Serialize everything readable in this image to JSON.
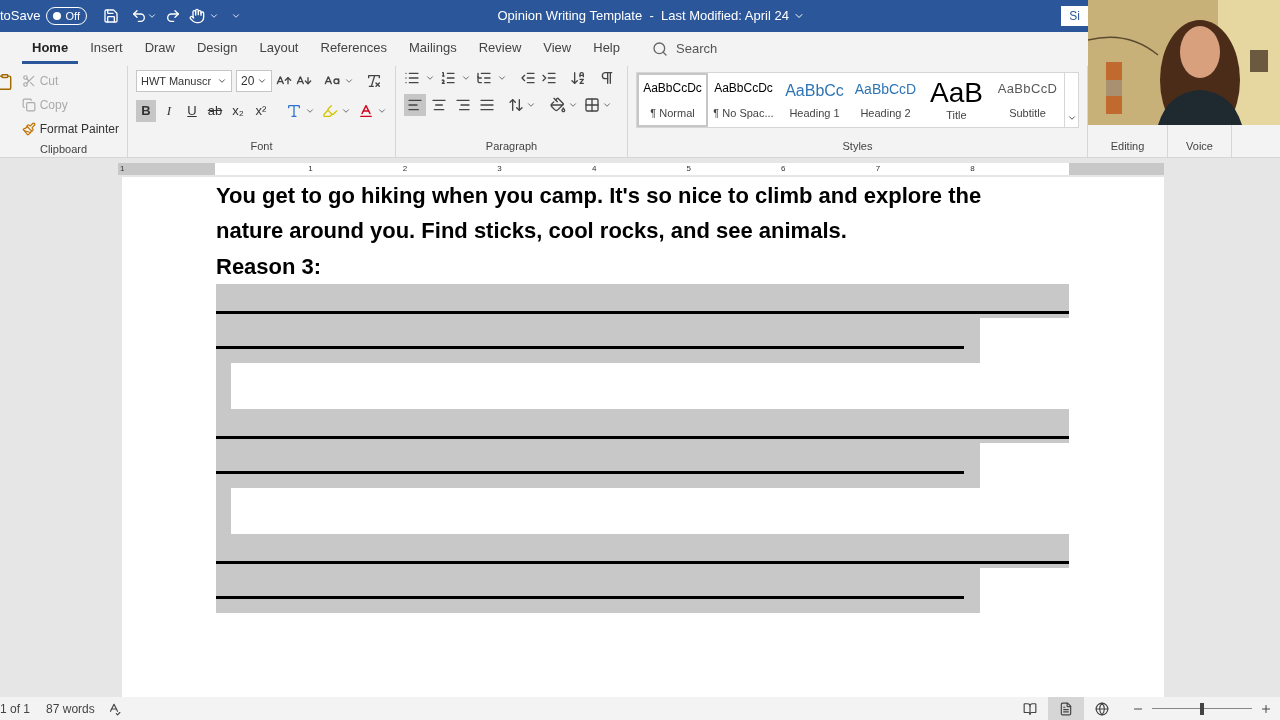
{
  "title_bar": {
    "autosave_label": "toSave",
    "autosave": {
      "label": "Off",
      "on": false
    },
    "title": "Opinion Writing Template  -  Last Modified: April 24",
    "sign_in": "Si"
  },
  "tabs": [
    {
      "label": "Home",
      "selected": true
    },
    {
      "label": "Insert",
      "selected": false
    },
    {
      "label": "Draw",
      "selected": false
    },
    {
      "label": "Design",
      "selected": false
    },
    {
      "label": "Layout",
      "selected": false
    },
    {
      "label": "References",
      "selected": false
    },
    {
      "label": "Mailings",
      "selected": false
    },
    {
      "label": "Review",
      "selected": false
    },
    {
      "label": "View",
      "selected": false
    },
    {
      "label": "Help",
      "selected": false
    }
  ],
  "search": {
    "placeholder": "Search"
  },
  "clipboard": {
    "label": "Clipboard",
    "items": [
      {
        "label": "Cut",
        "disabled": true
      },
      {
        "label": "Copy",
        "disabled": true
      },
      {
        "label": "Format Painter",
        "disabled": false
      }
    ]
  },
  "font": {
    "label": "Font",
    "font_name": "HWT Manuscr",
    "font_size": "20",
    "format_buttons": [
      {
        "label": "B",
        "selected": true
      },
      {
        "label": "I",
        "selected": false
      },
      {
        "label": "U",
        "selected": false
      },
      {
        "label": "ab",
        "selected": false
      },
      {
        "label": "x₂",
        "selected": false
      },
      {
        "label": "x²",
        "selected": false
      }
    ]
  },
  "paragraph": {
    "label": "Paragraph",
    "alignment": [
      {
        "kind": "left",
        "selected": true
      },
      {
        "kind": "center",
        "selected": false
      },
      {
        "kind": "right",
        "selected": false
      },
      {
        "kind": "justify",
        "selected": false
      }
    ]
  },
  "styles": {
    "label": "Styles",
    "items": [
      {
        "sample": "AaBbCcDc",
        "label": "¶ Normal",
        "kind": "body",
        "selected": true
      },
      {
        "sample": "AaBbCcDc",
        "label": "¶ No Spac...",
        "kind": "body",
        "selected": false
      },
      {
        "sample": "AaBbCc",
        "label": "Heading 1",
        "kind": "heading1",
        "selected": false
      },
      {
        "sample": "AaBbCcD",
        "label": "Heading 2",
        "kind": "heading2",
        "selected": false
      },
      {
        "sample": "AaB",
        "label": "Title",
        "kind": "title",
        "selected": false
      },
      {
        "sample": "AaBbCcD",
        "label": "Subtitle",
        "kind": "subtitle",
        "selected": false
      }
    ]
  },
  "editing": {
    "label": "Editing"
  },
  "voice": {
    "label": "Voice"
  },
  "ruler": {
    "marks": [
      "1",
      "1",
      "2",
      "3",
      "4",
      "5",
      "6",
      "7",
      "8"
    ]
  },
  "document": {
    "paragraph": "You get to go hiking when you camp. It's so nice to climb and explore the nature around you. Find sticks, cool rocks, and see animals.",
    "heading": "Reason 3:",
    "handwriting_sets": [
      {
        "kind": "lines"
      },
      {
        "kind": "lines"
      },
      {
        "kind": "lines"
      }
    ]
  },
  "status_bar": {
    "page": "1 of 1",
    "words": "87 words",
    "views": [
      {
        "kind": "read",
        "selected": false
      },
      {
        "kind": "print",
        "selected": true
      },
      {
        "kind": "web",
        "selected": false
      }
    ],
    "zoom": {
      "level": 0.5
    }
  }
}
